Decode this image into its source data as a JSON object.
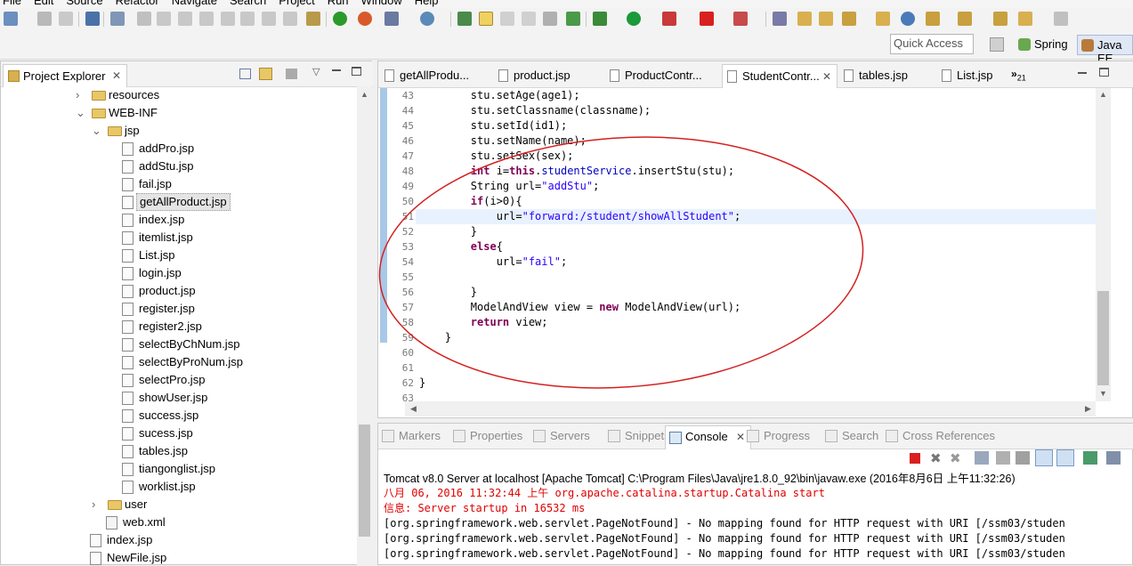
{
  "menu": [
    "File",
    "Edit",
    "Source",
    "Refactor",
    "Navigate",
    "Search",
    "Project",
    "Run",
    "Window",
    "Help"
  ],
  "quick_access": {
    "placeholder": "Quick Access"
  },
  "perspectives": [
    "Spring",
    "Java EE"
  ],
  "project_explorer": {
    "title": "Project Explorer",
    "items": [
      {
        "label": "resources",
        "type": "folder",
        "expanded": false,
        "level": 1
      },
      {
        "label": "WEB-INF",
        "type": "folder",
        "expanded": true,
        "level": 1
      },
      {
        "label": "jsp",
        "type": "folder",
        "expanded": true,
        "level": 2
      },
      {
        "label": "addPro.jsp",
        "type": "file",
        "level": 3
      },
      {
        "label": "addStu.jsp",
        "type": "file",
        "level": 3
      },
      {
        "label": "fail.jsp",
        "type": "file",
        "level": 3
      },
      {
        "label": "getAllProduct.jsp",
        "type": "file",
        "level": 3,
        "selected": true
      },
      {
        "label": "index.jsp",
        "type": "file",
        "level": 3
      },
      {
        "label": "itemlist.jsp",
        "type": "file",
        "level": 3
      },
      {
        "label": "List.jsp",
        "type": "file",
        "level": 3
      },
      {
        "label": "login.jsp",
        "type": "file",
        "level": 3
      },
      {
        "label": "product.jsp",
        "type": "file",
        "level": 3
      },
      {
        "label": "register.jsp",
        "type": "file",
        "level": 3
      },
      {
        "label": "register2.jsp",
        "type": "file",
        "level": 3
      },
      {
        "label": "selectByChNum.jsp",
        "type": "file",
        "level": 3
      },
      {
        "label": "selectByProNum.jsp",
        "type": "file",
        "level": 3
      },
      {
        "label": "selectPro.jsp",
        "type": "file",
        "level": 3
      },
      {
        "label": "showUser.jsp",
        "type": "file",
        "level": 3
      },
      {
        "label": "success.jsp",
        "type": "file",
        "level": 3
      },
      {
        "label": "sucess.jsp",
        "type": "file",
        "level": 3
      },
      {
        "label": "tables.jsp",
        "type": "file",
        "level": 3
      },
      {
        "label": "tiangonglist.jsp",
        "type": "file",
        "level": 3
      },
      {
        "label": "worklist.jsp",
        "type": "file",
        "level": 3
      },
      {
        "label": "user",
        "type": "folder",
        "expanded": false,
        "level": 2
      },
      {
        "label": "web.xml",
        "type": "xml",
        "level": 2
      },
      {
        "label": "index.jsp",
        "type": "file",
        "level": 1
      },
      {
        "label": "NewFile.jsp",
        "type": "file",
        "level": 1
      }
    ]
  },
  "editor": {
    "tabs": [
      {
        "label": "getAllProdu...",
        "active": false
      },
      {
        "label": "product.jsp",
        "active": false
      },
      {
        "label": "ProductContr...",
        "active": false
      },
      {
        "label": "StudentContr...",
        "active": true
      },
      {
        "label": "tables.jsp",
        "active": false
      },
      {
        "label": "List.jsp",
        "active": false
      }
    ],
    "overflow": "»",
    "overflow_count": "21",
    "lines": [
      {
        "n": "43",
        "html": "        stu.setAge(age1);"
      },
      {
        "n": "44",
        "html": "        stu.setClassname(classname);"
      },
      {
        "n": "45",
        "html": "        stu.setId(id1);"
      },
      {
        "n": "46",
        "html": "        stu.setName(name);"
      },
      {
        "n": "47",
        "html": "        stu.setSex(sex);"
      },
      {
        "n": "48",
        "html": "        int i=this.studentService.insertStu(stu);"
      },
      {
        "n": "49",
        "html": "        String url=\"addStu\";"
      },
      {
        "n": "50",
        "html": "        if(i>0){"
      },
      {
        "n": "51",
        "html": "            url=\"forward:/student/showAllStudent\";"
      },
      {
        "n": "52",
        "html": "        }"
      },
      {
        "n": "53",
        "html": "        else{"
      },
      {
        "n": "54",
        "html": "            url=\"fail\";"
      },
      {
        "n": "55",
        "html": ""
      },
      {
        "n": "56",
        "html": "        }"
      },
      {
        "n": "57",
        "html": "        ModelAndView view = new ModelAndView(url);"
      },
      {
        "n": "58",
        "html": "        return view;"
      },
      {
        "n": "59",
        "html": "    }"
      },
      {
        "n": "60",
        "html": ""
      },
      {
        "n": "61",
        "html": ""
      },
      {
        "n": "62",
        "html": "}"
      },
      {
        "n": "63",
        "html": ""
      }
    ]
  },
  "console": {
    "tabs": [
      "Markers",
      "Properties",
      "Servers",
      "Snippets",
      "Console",
      "Progress",
      "Search",
      "Cross References"
    ],
    "active_tab": "Console",
    "header": "Tomcat v8.0 Server at localhost [Apache Tomcat] C:\\Program Files\\Java\\jre1.8.0_92\\bin\\javaw.exe (2016年8月6日 上午11:32:26)",
    "lines": [
      {
        "text": "八月 06, 2016 11:32:44 上午 org.apache.catalina.startup.Catalina start",
        "color": "#e00000"
      },
      {
        "text": "信息: Server startup in 16532 ms",
        "color": "#e00000"
      },
      {
        "text": "[org.springframework.web.servlet.PageNotFound] - No mapping found for HTTP request with URI [/ssm03/studen",
        "color": "#000000"
      },
      {
        "text": "[org.springframework.web.servlet.PageNotFound] - No mapping found for HTTP request with URI [/ssm03/studen",
        "color": "#000000"
      },
      {
        "text": "[org.springframework.web.servlet.PageNotFound] - No mapping found for HTTP request with URI [/ssm03/studen",
        "color": "#000000"
      }
    ]
  },
  "colors": {
    "annotation": "#d42020",
    "keyword": "#7f0055",
    "string": "#2a00ff",
    "field": "#0000c0",
    "console_error": "#e00000"
  }
}
